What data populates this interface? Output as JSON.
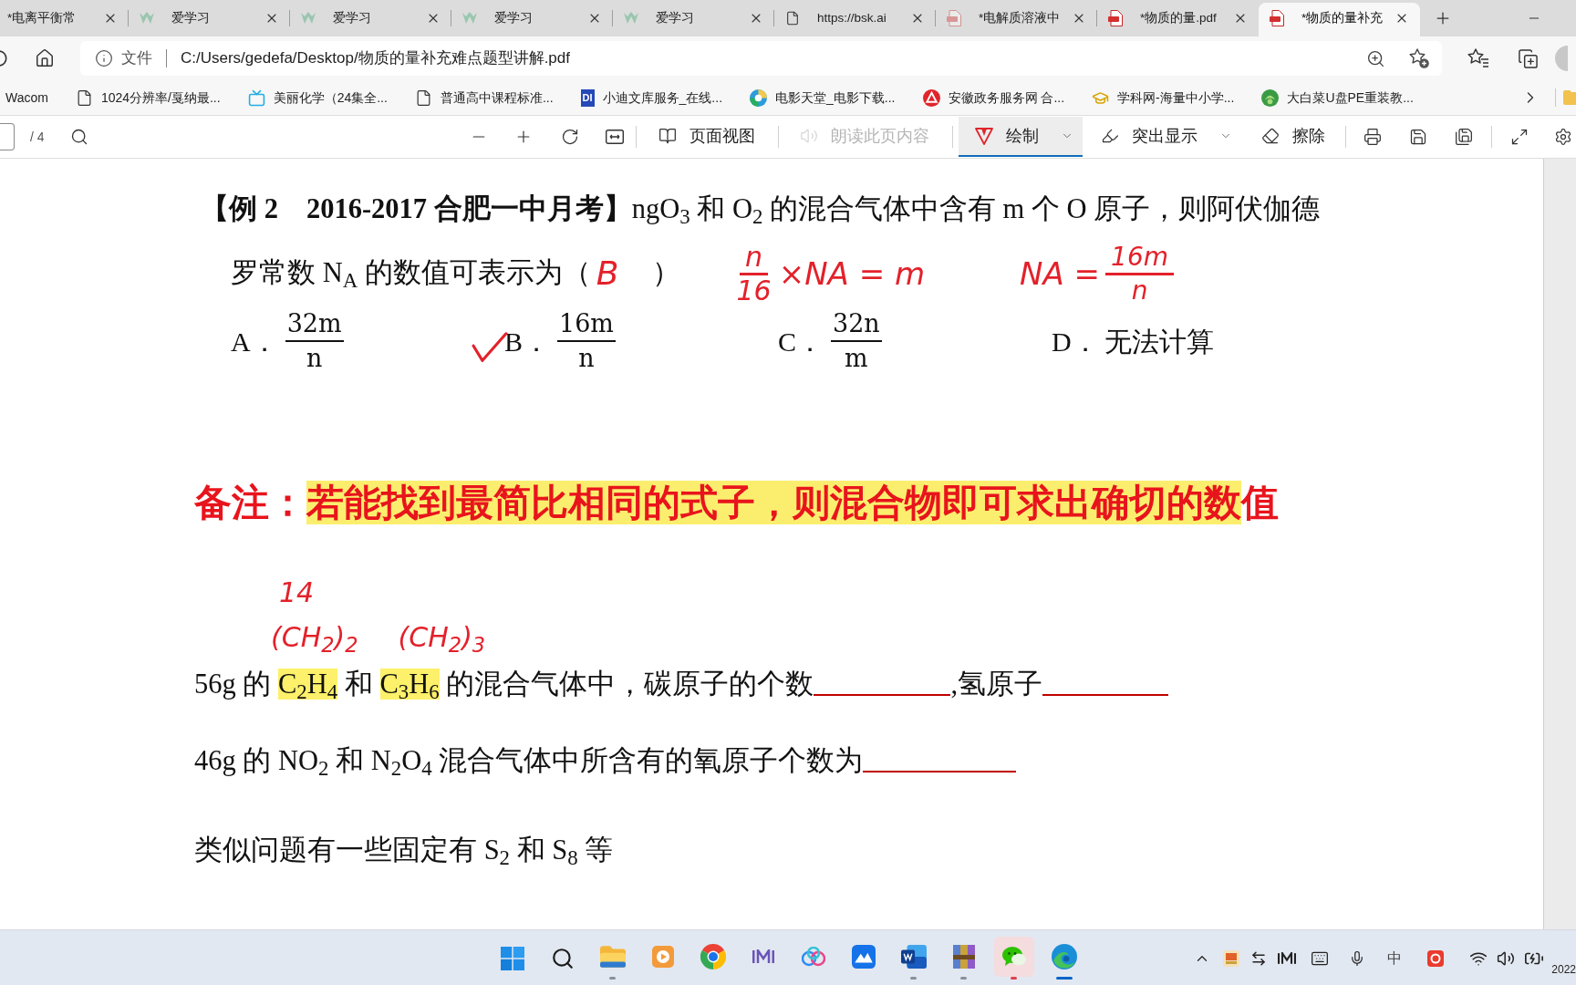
{
  "tabs": [
    {
      "title": "*电离平衡常",
      "kind": "none",
      "selected": false
    },
    {
      "title": "爱学习",
      "kind": "app",
      "sleeping": true,
      "selected": false
    },
    {
      "title": "爱学习",
      "kind": "app",
      "sleeping": true,
      "selected": false
    },
    {
      "title": "爱学习",
      "kind": "app",
      "sleeping": true,
      "selected": false
    },
    {
      "title": "爱学习",
      "kind": "app",
      "sleeping": true,
      "selected": false
    },
    {
      "title": "https://bsk.ai",
      "kind": "page",
      "sleeping": false,
      "selected": false
    },
    {
      "title": "*电解质溶液中",
      "kind": "pdf",
      "sleeping": true,
      "selected": false
    },
    {
      "title": "*物质的量.pdf",
      "kind": "pdf",
      "sleeping": false,
      "selected": false
    },
    {
      "title": "*物质的量补充",
      "kind": "pdf",
      "sleeping": false,
      "selected": true
    }
  ],
  "address_bar": {
    "label": "文件",
    "url": "C:/Users/gedefa/Desktop/物质的量补充难点题型讲解.pdf"
  },
  "bookmarks": [
    {
      "label": "Wacom"
    },
    {
      "label": "1024分辨率/戛纳最..."
    },
    {
      "label": "美丽化学（24集全..."
    },
    {
      "label": "普通高中课程标准..."
    },
    {
      "label": "小迪文库服务_在线...",
      "logo_text": "DI"
    },
    {
      "label": "电影天堂_电影下载..."
    },
    {
      "label": "安徽政务服务网 合..."
    },
    {
      "label": "学科网-海量中小学..."
    },
    {
      "label": "大白菜U盘PE重装教..."
    }
  ],
  "pdf_toolbar": {
    "page_count": "/ 4",
    "buttons": [
      {
        "label": "页面视图",
        "selected": false,
        "disabled": false,
        "menu": false
      },
      {
        "label": "朗读此页内容",
        "selected": false,
        "disabled": true,
        "menu": false
      },
      {
        "label": "绘制",
        "selected": true,
        "disabled": false,
        "menu": true
      },
      {
        "label": "突出显示",
        "selected": false,
        "disabled": false,
        "menu": true
      },
      {
        "label": "擦除",
        "selected": false,
        "disabled": false,
        "menu": false
      }
    ]
  },
  "document": {
    "question_line_1": "**【例 2　2016-2017 合肥一中月考】**ngO$_{3}$ 和 O$_{2}$ 的混合气体中含有 m 个 O 原子，则阿伏伽德",
    "question_line_2": "罗常数 N$_{A}$ 的数值可表示为（",
    "handwritten_answer": "B",
    "question_line_2_end": "）",
    "handwritten_work": [
      {
        "kind": "fraction-first",
        "numerator": "n",
        "denominator": "16",
        "text": "×NA = m"
      },
      {
        "kind": "fraction-last",
        "text": "NA =",
        "numerator": "16m",
        "denominator": "n"
      }
    ],
    "options": [
      {
        "kind": "fraction",
        "letter": "A．",
        "numerator": "32m",
        "denominator": "n",
        "checked": false
      },
      {
        "kind": "fraction",
        "letter": "B．",
        "numerator": "16m",
        "denominator": "n",
        "checked": true
      },
      {
        "kind": "fraction",
        "letter": "C．",
        "numerator": "32n",
        "denominator": "m",
        "checked": false
      },
      {
        "kind": "text",
        "letter": "D．",
        "text": "无法计算",
        "checked": false
      }
    ],
    "remark": [
      {
        "text": "备注：",
        "highlighted": false
      },
      {
        "text": "若能找到最简比相同的式子，则混合物即可求出确切的数",
        "highlighted": true
      },
      {
        "text": "值",
        "highlighted": false
      }
    ],
    "handwritten_mass": "14",
    "handwritten_formulas": [
      "(CH$_{2}$)$_{2}$",
      "(CH$_{2}$)$_{3}$"
    ],
    "exercises": [
      {
        "segments": [
          {
            "kind": "text",
            "parts": [
              {
                "text": "56g 的 ",
                "highlighted": false
              },
              {
                "text": "C$_{2}$H$_{4}$",
                "highlighted": true
              },
              {
                "text": " 和 ",
                "highlighted": false
              },
              {
                "text": "C$_{3}$H$_{6}$",
                "highlighted": true
              },
              {
                "text": " 的混合气体中，碳原子的个数",
                "highlighted": false
              }
            ]
          },
          {
            "kind": "blank"
          },
          {
            "kind": "text",
            "parts": [
              {
                "text": ",氢原子",
                "highlighted": false
              }
            ]
          },
          {
            "kind": "blank"
          }
        ]
      },
      {
        "segments": [
          {
            "kind": "text",
            "parts": [
              {
                "text": "46g 的 NO$_{2}$ 和 N$_{2}$O$_{4}$ 混合气体中所含有的氧原子个数为",
                "highlighted": false
              }
            ]
          },
          {
            "kind": "blank"
          }
        ]
      },
      {
        "segments": [
          {
            "kind": "text",
            "parts": [
              {
                "text": "类似问题有一些固定有 S$_{2}$ 和 S$_{8}$ 等",
                "highlighted": false
              }
            ]
          }
        ]
      }
    ]
  },
  "taskbar": {
    "apps": [
      {
        "running": true,
        "selected": false,
        "flashing": false
      },
      {
        "running": false,
        "selected": false,
        "flashing": false
      },
      {
        "running": false,
        "selected": false,
        "flashing": false
      },
      {
        "running": false,
        "selected": false,
        "flashing": false
      },
      {
        "running": false,
        "selected": false,
        "flashing": false
      },
      {
        "running": false,
        "selected": false,
        "flashing": false
      },
      {
        "running": true,
        "selected": false,
        "flashing": false
      },
      {
        "running": true,
        "selected": false,
        "flashing": false
      },
      {
        "running": true,
        "selected": false,
        "flashing": true
      },
      {
        "running": true,
        "selected": true,
        "flashing": false
      }
    ],
    "input_method": "中",
    "clock": "2022"
  }
}
